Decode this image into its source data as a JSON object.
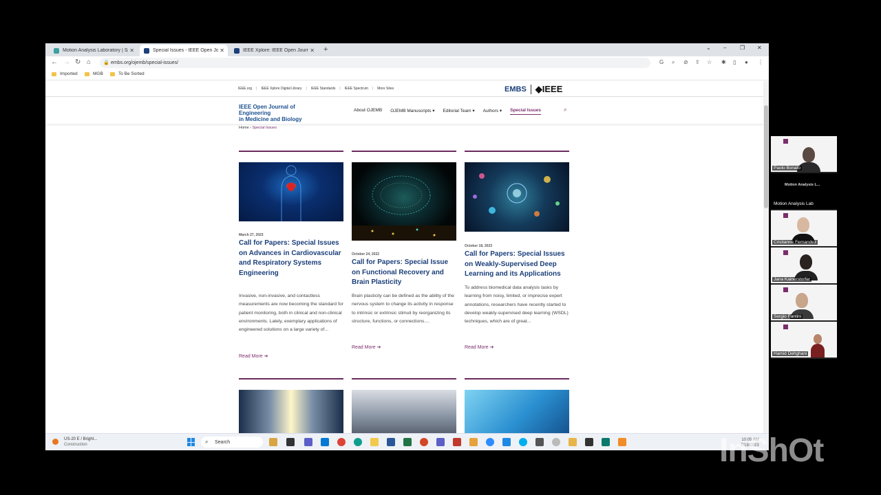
{
  "browser": {
    "tabs": [
      {
        "title": "Motion Analysis Laboratory | Sp...",
        "favicon_color": "#3aa0a0",
        "active": false
      },
      {
        "title": "Special Issues - IEEE Open Journ...",
        "favicon_color": "#1b3f7a",
        "active": true
      },
      {
        "title": "IEEE Xplore: IEEE Open Journal o...",
        "favicon_color": "#1b3f7a",
        "active": false
      }
    ],
    "new_tab_glyph": "+",
    "window_controls": {
      "menu": "⌄",
      "minimize": "–",
      "maximize": "❐",
      "close": "✕"
    },
    "nav": {
      "back": "←",
      "forward": "→",
      "reload": "↻",
      "home": "⌂"
    },
    "url": "embs.org/ojemb/special-issues/",
    "bookmarks": [
      "Imported",
      "MGB",
      "To Be Sorted"
    ]
  },
  "site": {
    "util_links": [
      "IEEE.org",
      "IEEE Xplore Digital Library",
      "IEEE Standards",
      "IEEE Spectrum",
      "More Sites"
    ],
    "brand_embs": "EMBS",
    "brand_ieee": "◆IEEE",
    "logo_line1": "IEEE Open Journal of Engineering",
    "logo_line2": "in Medicine and Biology",
    "nav": [
      "About OJEMB",
      "OJEMB Manuscripts ▾",
      "Editorial Team ▾",
      "Authors ▾",
      "Special Issues"
    ],
    "breadcrumb_home": "Home",
    "breadcrumb_sep": "›",
    "breadcrumb_current": "Special Issues"
  },
  "cards": [
    {
      "date": "March 27, 2023",
      "title": "Call for Papers: Special Issues on Advances in Cardiovascular and Respiratory Systems Engineering",
      "excerpt": "Invasive, non-invasive, and contactless measurements are now becoming the standard for patient monitoring, both in clinical and non-clinical environments. Lately, exemplary applications of engineered solutions on a large variety of...",
      "read_more": "Read More ➔",
      "image_theme": "blue-body"
    },
    {
      "date": "October 24, 2022",
      "title": "Call for Papers: Special Issue on Functional Recovery and Brain Plasticity",
      "excerpt": "Brain plasticity can be defined as the ability of the nervous system to change its activity in response to intrinsic or extrinsic stimuli by reorganizing its structure, functions, or connections....",
      "read_more": "Read More ➔",
      "image_theme": "neural-brain"
    },
    {
      "date": "October 18, 2023",
      "title": "Call for Papers: Special Issues on Weakly-Supervised Deep Learning and its Applications",
      "excerpt": "To address biomedical data analysis tasks by learning from noisy, limited, or imprecise expert annotations, researchers have recently started to develop weakly-supervised deep learning (WSDL) techniques, which are of great...",
      "read_more": "Read More ➔",
      "image_theme": "data-lights"
    }
  ],
  "taskbar": {
    "weather_line1": "US-20 E / Bright...",
    "weather_line2": "Construction",
    "search_label": "Search",
    "time": "10:05 AM",
    "date": "7/19/2023"
  },
  "zoom": {
    "participants": [
      "Paolo Bonato",
      "Motion Analysis Lab",
      "Cristianne Fernandez",
      "Jana Kainerstorfer",
      "Sergio Fantini",
      "Hamid Dehghani"
    ],
    "room_label": "Motion Analysis L..."
  },
  "watermark": "InShOt"
}
